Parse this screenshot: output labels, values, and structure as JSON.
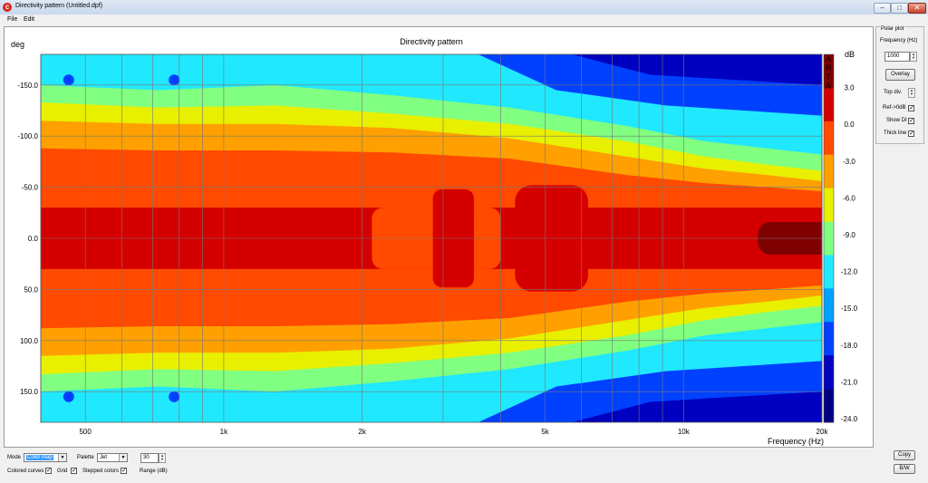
{
  "window": {
    "title": "Directivity pattern (Untitled.dpf)"
  },
  "menu": {
    "items": [
      "File",
      "Edit"
    ]
  },
  "chart_data": {
    "type": "heatmap",
    "title": "Directivity pattern",
    "xlabel": "Frequency (Hz)",
    "ylabel": "deg",
    "xscale": "log",
    "xlim": [
      400,
      20000
    ],
    "ylim": [
      -180,
      180
    ],
    "x_ticks": [
      "500",
      "1k",
      "2k",
      "5k",
      "10k",
      "20k"
    ],
    "x_tick_values": [
      500,
      1000,
      2000,
      5000,
      10000,
      20000
    ],
    "y_ticks": [
      "-150.0",
      "-100.0",
      "-50.0",
      "0.0",
      "50.0",
      "100.0",
      "150.0"
    ],
    "y_tick_values": [
      -150,
      -100,
      -50,
      0,
      50,
      100,
      150
    ],
    "colorbar": {
      "unit": "dB",
      "labels": [
        "3.0",
        "0.0",
        "-3.0",
        "-6.0",
        "-9.0",
        "-12.0",
        "-15.0",
        "-18.0",
        "-21.0",
        "-24.0"
      ],
      "colors": [
        "#7f0000",
        "#d40000",
        "#ff4a00",
        "#ffa000",
        "#e8f000",
        "#80ff80",
        "#20e8ff",
        "#00a0ff",
        "#0040ff",
        "#0000c0",
        "#000080"
      ]
    },
    "watermark": "ARTA",
    "grid": true,
    "palette": "Jet"
  },
  "polar_panel": {
    "title": "Polar plot",
    "frequency_label": "Frequency (Hz)",
    "frequency_value": "1000",
    "overlay_button": "Overlay",
    "top_div_label": "Top div.",
    "ref_label": "Ref->0dB",
    "show_di_label": "Show DI",
    "thick_line_label": "Thick line",
    "ref_checked": true,
    "show_di_checked": true,
    "thick_line_checked": true
  },
  "bottom": {
    "mode_label": "Mode",
    "mode_value": "Color map",
    "palette_label": "Palette",
    "palette_value": "Jet",
    "range_value": "30",
    "range_label": "Range (dB)",
    "colored_curves_label": "Colored curves",
    "grid_label": "Grid",
    "stepped_colors_label": "Stepped colors",
    "colored_curves_checked": true,
    "grid_checked": true,
    "stepped_colors_checked": true,
    "copy_button": "Copy",
    "bw_button": "B/W"
  }
}
